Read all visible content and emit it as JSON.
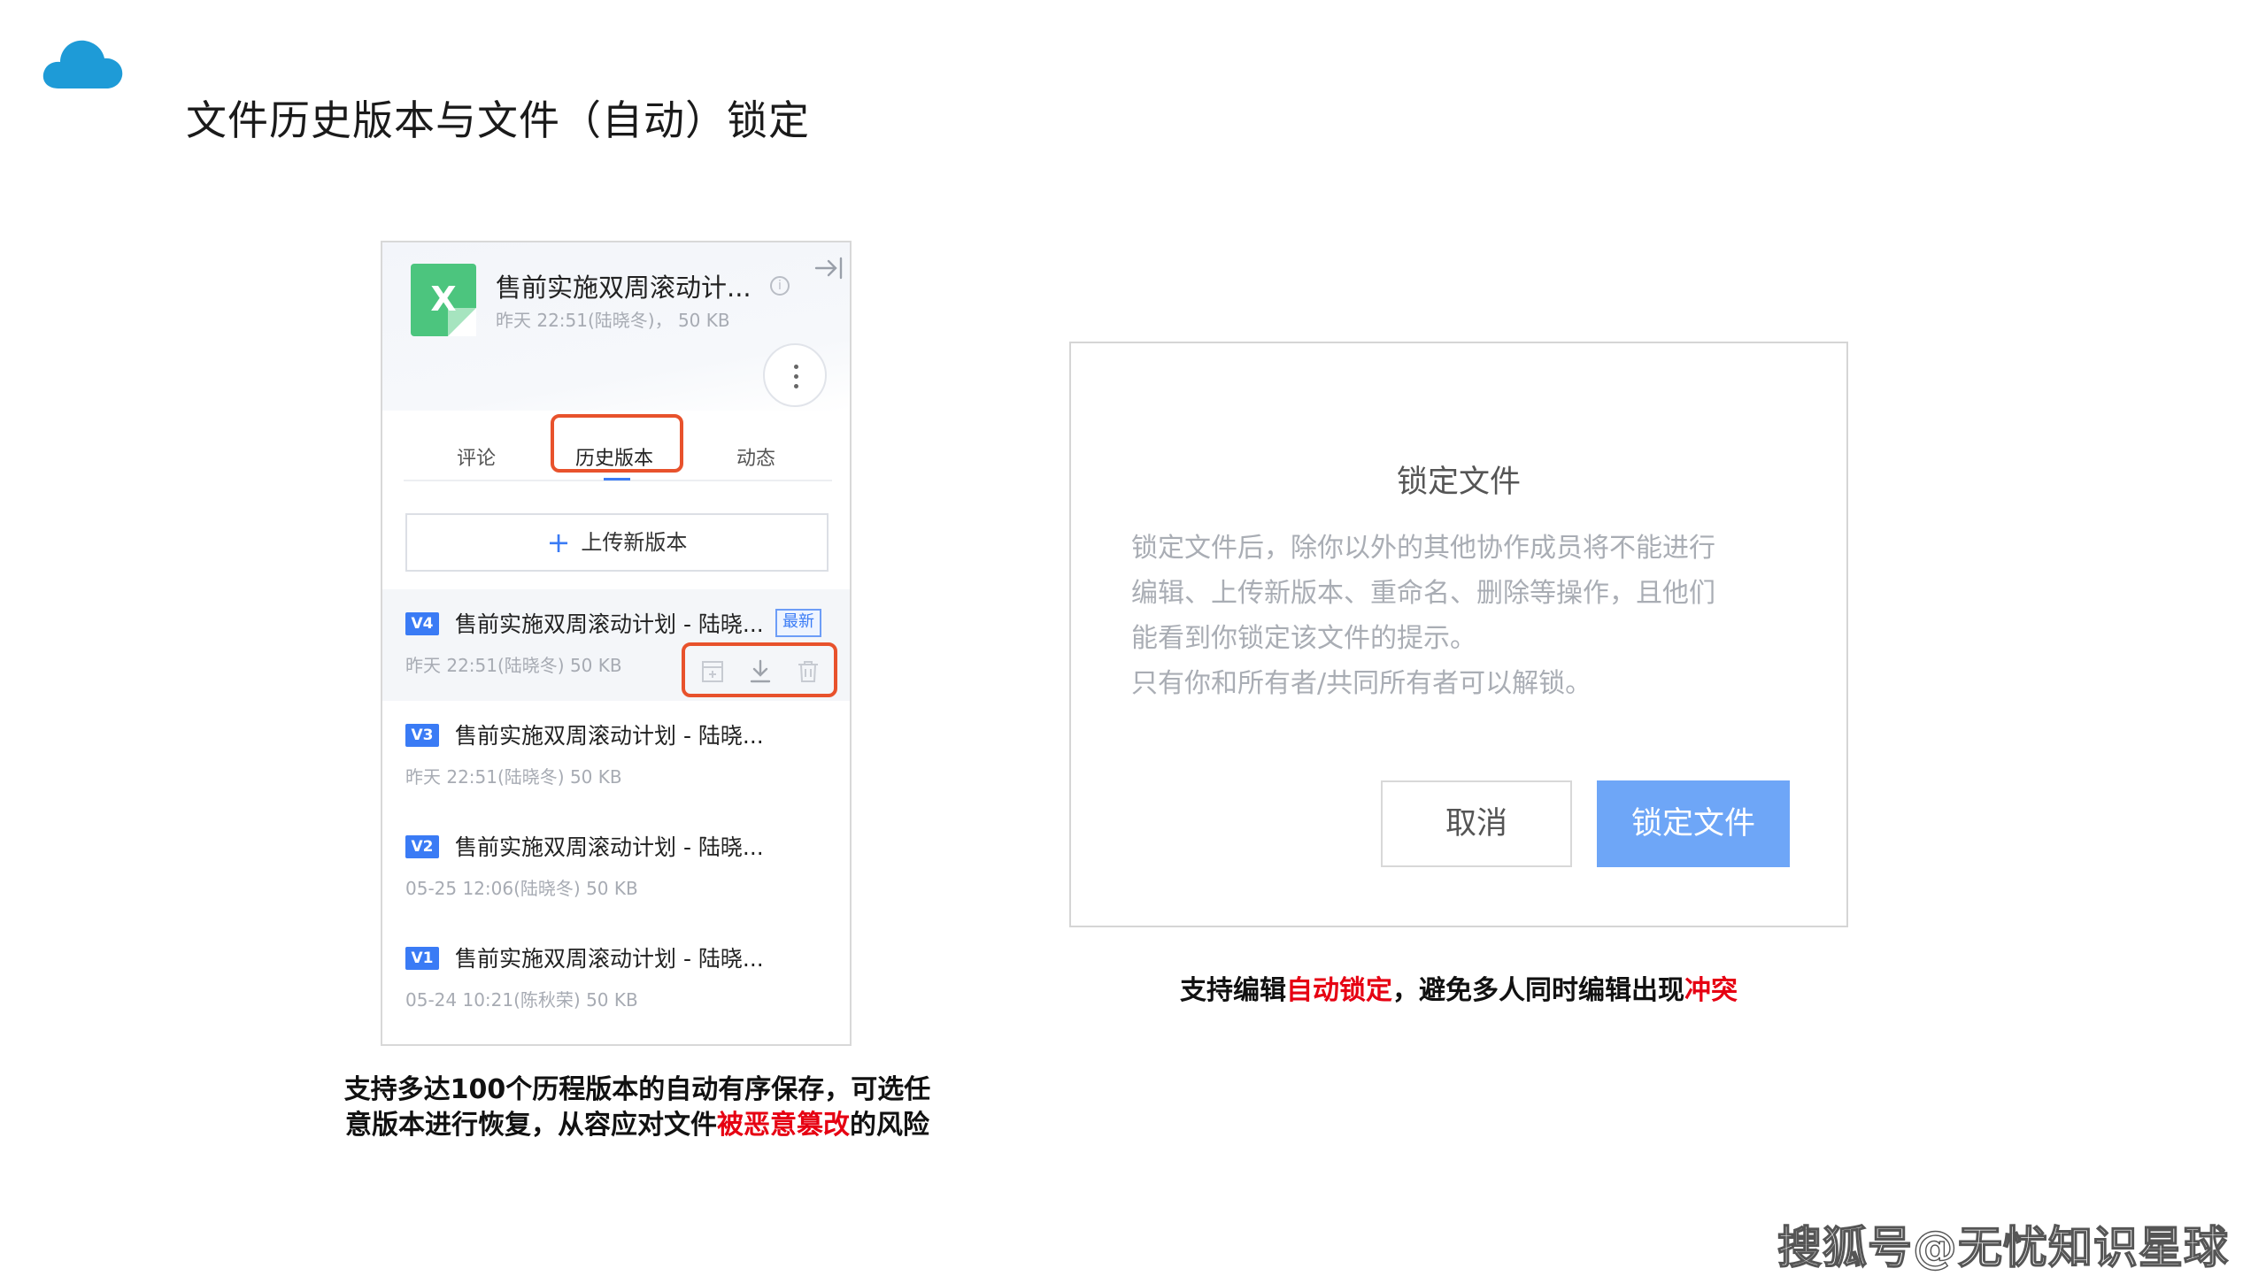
{
  "slide": {
    "title": "文件历史版本与文件（自动）锁定",
    "watermark": "搜狐号@无忧知识星球"
  },
  "history_panel": {
    "file_icon_letter": "X",
    "file_name": "售前实施双周滚动计...",
    "file_meta": "昨天 22:51(陆晓冬)，  50 KB",
    "tabs": [
      {
        "label": "评论",
        "active": false
      },
      {
        "label": "历史版本",
        "active": true
      },
      {
        "label": "动态",
        "active": false
      }
    ],
    "upload_plus": "+",
    "upload_label": "上传新版本",
    "versions": [
      {
        "badge": "V4",
        "name": "售前实施双周滚动计划 - 陆晓...",
        "meta": "昨天 22:51(陆晓冬)   50 KB",
        "tag": "最新"
      },
      {
        "badge": "V3",
        "name": "售前实施双周滚动计划 - 陆晓...",
        "meta": "昨天 22:51(陆晓冬)   50 KB"
      },
      {
        "badge": "V2",
        "name": "售前实施双周滚动计划 - 陆晓...",
        "meta": "05-25 12:06(陆晓冬)   50 KB"
      },
      {
        "badge": "V1",
        "name": "售前实施双周滚动计划 - 陆晓...",
        "meta": "05-24 10:21(陈秋荣)   50 KB"
      }
    ]
  },
  "caption_left": {
    "line1": "支持多达100个历程版本的自动有序保存，可选任",
    "line2_a": "意版本进行恢复，从容应对文件",
    "line2_red": "被恶意篡改",
    "line2_b": "的风险"
  },
  "lock_dialog": {
    "title": "锁定文件",
    "body_lines": [
      "锁定文件后，除你以外的其他协作成员将不能进行",
      "编辑、上传新版本、重命名、删除等操作，且他们",
      "能看到你锁定该文件的提示。",
      "只有你和所有者/共同所有者可以解锁。"
    ],
    "cancel_label": "取消",
    "confirm_label": "锁定文件"
  },
  "caption_right": {
    "a": "支持编辑",
    "red1": "自动锁定",
    "b": "，避免多人同时编辑出现",
    "red2": "冲突"
  },
  "colors": {
    "accent_blue": "#3a7bf5",
    "highlight_red": "#e8522c",
    "excel_green": "#4cc57e",
    "cloud_blue": "#1e9bd7",
    "confirm_button": "#6ea6f7"
  }
}
